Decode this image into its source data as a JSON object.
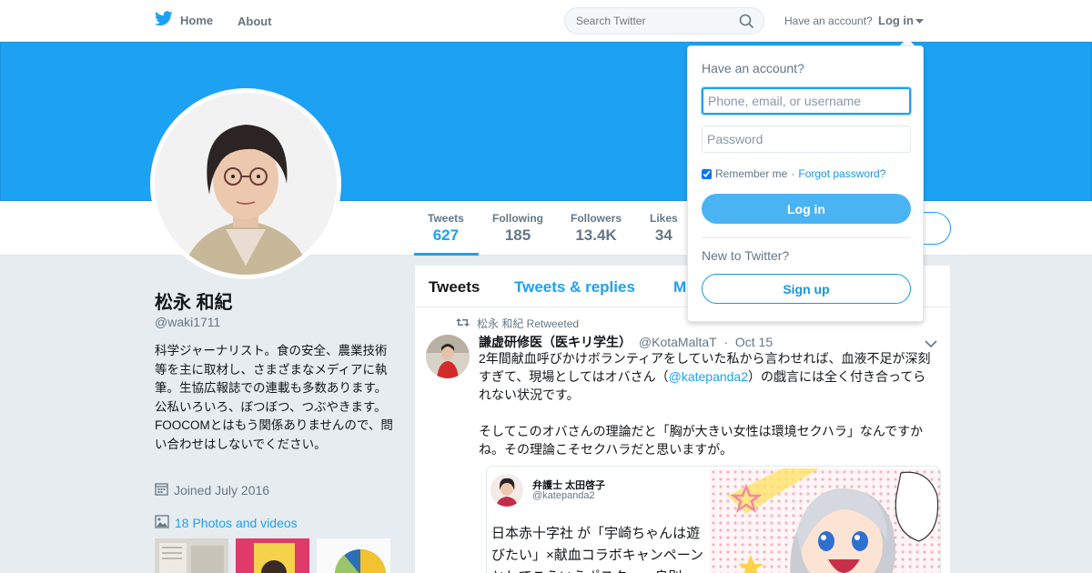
{
  "nav": {
    "home": "Home",
    "about": "About",
    "search_placeholder": "Search Twitter",
    "have_account": "Have an account?",
    "login": "Log in"
  },
  "profile": {
    "name": "松永 和紀",
    "handle": "@waki1711",
    "bio": "科学ジャーナリスト。食の安全、農業技術等を主に取材し、さまざまなメディアに執筆。生協広報誌での連載も多数あります。公私いろいろ、ぼつぼつ、つぶやきます。FOOCOMとはもう関係ありませんので、問い合わせはしないでください。",
    "joined": "Joined July 2016",
    "photos": "18 Photos and videos"
  },
  "stats": [
    {
      "label": "Tweets",
      "value": "627"
    },
    {
      "label": "Following",
      "value": "185"
    },
    {
      "label": "Followers",
      "value": "13.4K"
    },
    {
      "label": "Likes",
      "value": "34"
    }
  ],
  "timeline": {
    "tabs": {
      "tweets": "Tweets",
      "replies": "Tweets & replies",
      "media": "M"
    },
    "tweet": {
      "context": "松永 和紀 Retweeted",
      "name": "謙虚研修医（医キリ学生）",
      "handle": "@KotaMaltaT",
      "sep": "·",
      "date": "Oct 15",
      "text1a": "2年間献血呼びかけボランティアをしていた私から言わせれば、血液不足が深刻すぎて、現場としてはオバさん（",
      "mention": "@katepanda2",
      "text1b": "）の戯言には全く付き合ってられない状況です。",
      "text2": "そしてこのオバさんの理論だと「胸が大きい女性は環境セクハラ」なんですかね。その理論こそセクハラだと思いますが。",
      "quote": {
        "name": "弁護士 太田啓子",
        "handle": "@katepanda2",
        "text": "日本赤十字社 が「宇崎ちゃんは遊びたい」×献血コラボキャンペーンとしてこういうポスター。良則"
      }
    }
  },
  "dropdown": {
    "title": "Have an account?",
    "user_placeholder": "Phone, email, or username",
    "pass_placeholder": "Password",
    "remember": "Remember me",
    "dot": "·",
    "forgot": "Forgot password?",
    "login": "Log in",
    "new": "New to Twitter?",
    "signup": "Sign up"
  },
  "colors": {
    "brand": "#1da1f2",
    "banner": "#1da1f2",
    "muted": "#657786"
  }
}
